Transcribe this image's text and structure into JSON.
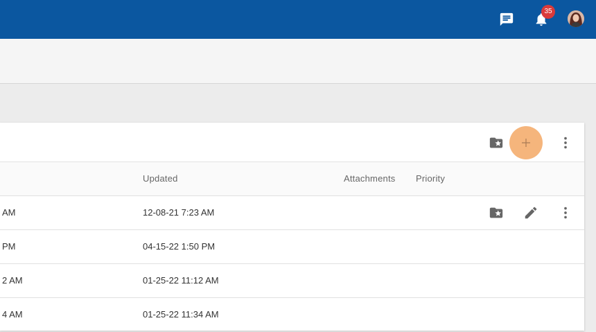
{
  "topbar": {
    "icons": [
      "chat-icon",
      "bell-icon",
      "avatar"
    ],
    "notification_count": "35"
  },
  "toolbar": {
    "icons": [
      "folder-star-icon",
      "plus-icon",
      "more-vert-icon"
    ]
  },
  "table": {
    "headers": {
      "updated": "Updated",
      "attachments": "Attachments",
      "priority": "Priority"
    },
    "rows": [
      {
        "left_fragment": "AM",
        "updated": "12-08-21 7:23 AM"
      },
      {
        "left_fragment": "PM",
        "updated": "04-15-22 1:50 PM"
      },
      {
        "left_fragment": "2 AM",
        "updated": "01-25-22 11:12 AM"
      },
      {
        "left_fragment": "4 AM",
        "updated": "01-25-22 11:34 AM"
      }
    ],
    "row_actions": [
      "folder-star-icon",
      "pencil-icon",
      "more-vert-icon"
    ]
  },
  "colors": {
    "topbar": "#0b57a0",
    "badge": "#d93a3a",
    "add_button_highlight": "#f5b57c"
  }
}
